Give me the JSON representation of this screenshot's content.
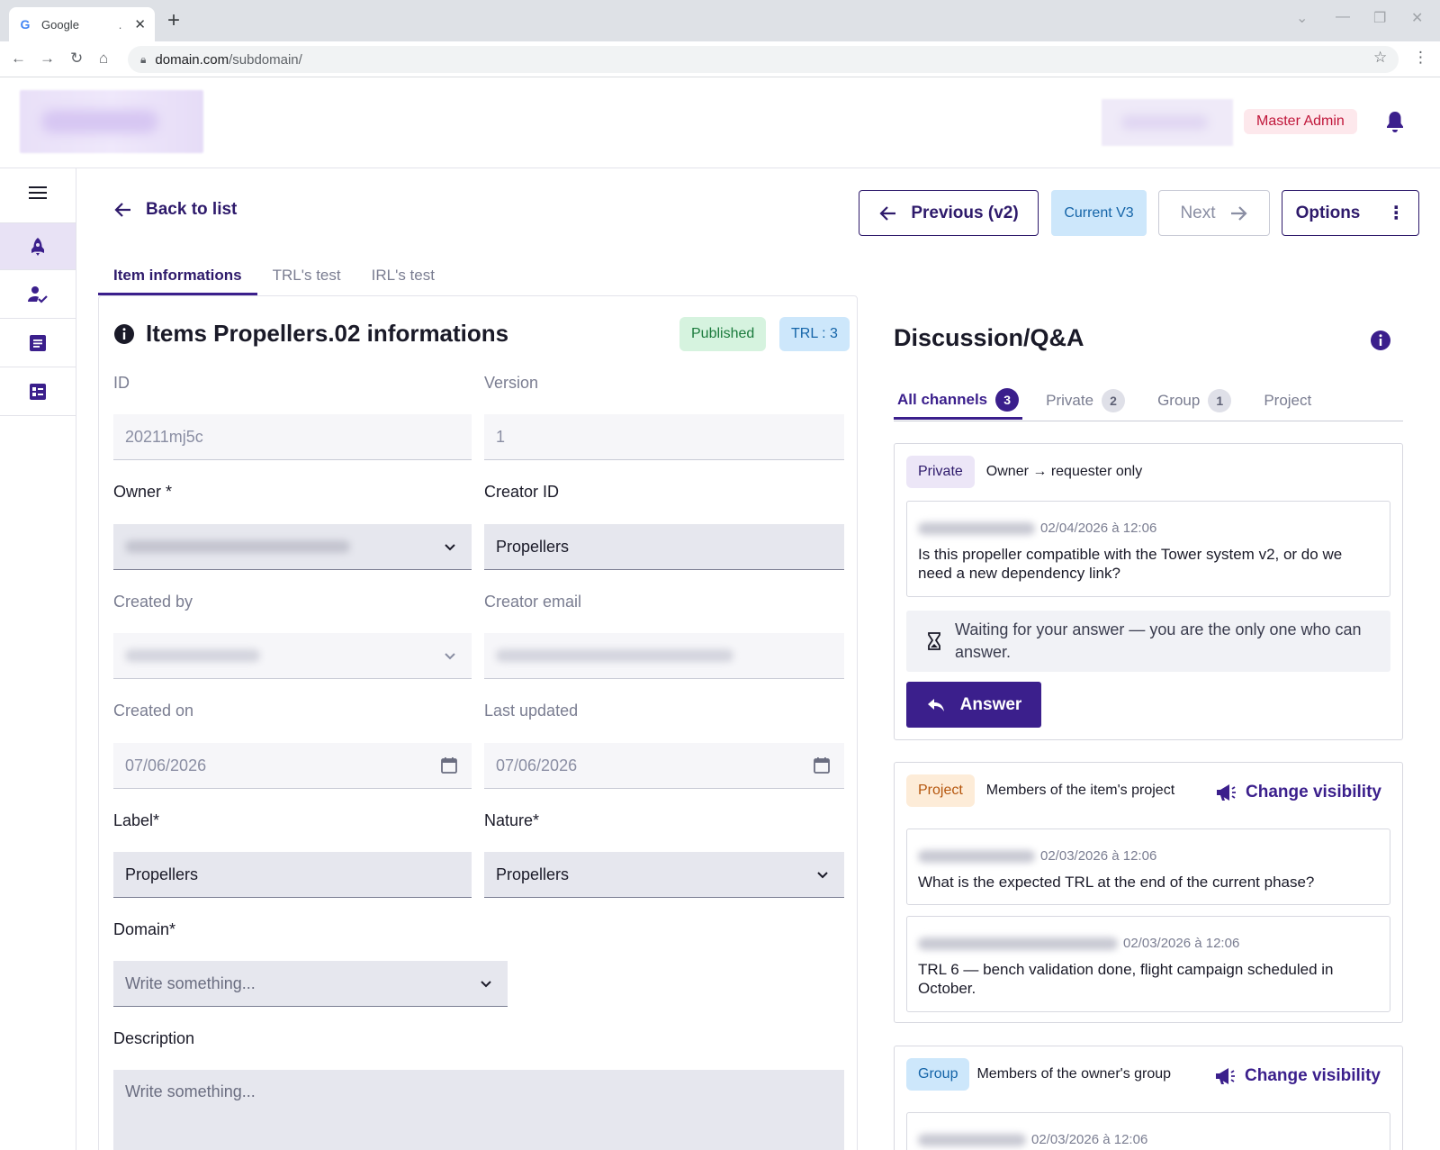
{
  "browser": {
    "tab_title": "Google",
    "tab_dot": ".",
    "url_domain": "domain.com",
    "url_path": "/subdomain/"
  },
  "header": {
    "role_badge": "Master Admin"
  },
  "toolbar": {
    "back_label": "Back to list",
    "previous_label": "Previous (v2)",
    "current_label": "Current V3",
    "next_label": "Next",
    "options_label": "Options"
  },
  "tabs": [
    {
      "label": "Item informations",
      "active": true
    },
    {
      "label": "TRL's test",
      "active": false
    },
    {
      "label": "IRL's test",
      "active": false
    }
  ],
  "item": {
    "title": "Items Propellers.02 informations",
    "status": "Published",
    "trl": "TRL : 3",
    "fields": {
      "id": {
        "label": "ID",
        "value": "20211mj5c"
      },
      "version": {
        "label": "Version",
        "value": "1"
      },
      "owner": {
        "label": "Owner *"
      },
      "creator_id": {
        "label": "Creator ID",
        "value": "Propellers"
      },
      "created_by": {
        "label": "Created by"
      },
      "creator_email": {
        "label": "Creator email"
      },
      "created_on": {
        "label": "Created on",
        "value": "07/06/2026"
      },
      "last_updated": {
        "label": "Last updated",
        "value": "07/06/2026"
      },
      "label": {
        "label": "Label*",
        "value": "Propellers"
      },
      "nature": {
        "label": "Nature*",
        "value": "Propellers"
      },
      "domain": {
        "label": "Domain*",
        "placeholder": "Write something..."
      },
      "description": {
        "label": "Description",
        "placeholder": "Write something..."
      }
    }
  },
  "discussion": {
    "title": "Discussion/Q&A",
    "channels": [
      {
        "label": "All channels",
        "count": "3",
        "active": true
      },
      {
        "label": "Private",
        "count": "2",
        "active": false
      },
      {
        "label": "Group",
        "count": "1",
        "active": false
      },
      {
        "label": "Project",
        "count": "",
        "active": false
      }
    ],
    "change_visibility_label": "Change visibility",
    "threads": [
      {
        "chip": "Private",
        "description": "Owner → requester only",
        "messages": [
          {
            "date": "02/04/2026 à 12:06",
            "text": "Is this propeller compatible with the Tower system v2, or do we need a new dependency link?"
          }
        ],
        "waiting_text": "Waiting for your answer — you are the only one who can answer.",
        "answer_label": "Answer"
      },
      {
        "chip": "Project",
        "description": "Members of the item's project",
        "messages": [
          {
            "date": "02/03/2026 à 12:06",
            "text": "What is the expected TRL at the end of the current phase?"
          },
          {
            "date": "02/03/2026 à 12:06",
            "text": "TRL 6 — bench validation done, flight campaign scheduled in October."
          }
        ]
      },
      {
        "chip": "Group",
        "description": "Members of the owner's group",
        "messages": [
          {
            "date": "02/03/2026 à 12:06",
            "text": ""
          }
        ]
      }
    ]
  },
  "colors": {
    "brand": "#3b1f8c",
    "published": "#1a7a3c",
    "info": "#1464a8",
    "admin": "#c0163a"
  }
}
